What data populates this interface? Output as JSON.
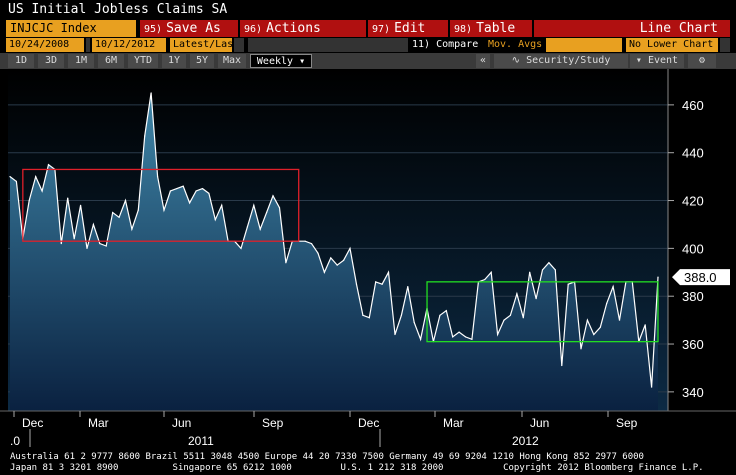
{
  "window": {
    "title": "US Initial Jobless Claims SA"
  },
  "toolbar": {
    "ticker": "INJCJC Index",
    "save": {
      "key": "95)",
      "label": "Save As"
    },
    "actions": {
      "key": "96)",
      "label": "Actions"
    },
    "edit": {
      "key": "97)",
      "label": "Edit"
    },
    "table": {
      "key": "98)",
      "label": "Table"
    },
    "chart_type": "Line Chart"
  },
  "range_bar": {
    "start_date": "10/24/2008",
    "end_date": "10/12/2012",
    "range": "Latest/Last",
    "compare": "11) Compare",
    "mov_avgs": "Mov. Avgs",
    "lower_chart": "No Lower Chart"
  },
  "period_bar": {
    "periods": [
      "1D",
      "3D",
      "1M",
      "6M",
      "YTD",
      "1Y",
      "5Y",
      "Max"
    ],
    "selected": "Weekly",
    "security_study": "Security/Study",
    "event": "Event"
  },
  "colors": {
    "accent": "#e8a020",
    "button_red": "#b01010",
    "line": "#ffffff",
    "box_red": "#e0202a",
    "box_green": "#22dd22"
  },
  "chart_data": {
    "type": "area",
    "title": "US Initial Jobless Claims SA",
    "y_ticks": [
      340,
      360,
      380,
      400,
      420,
      440,
      460
    ],
    "ylim": [
      332,
      475
    ],
    "last_value_label": "388.0",
    "x_month_labels": [
      "Dec",
      "Mar",
      "Jun",
      "Sep",
      "Dec",
      "Mar",
      "Jun",
      "Sep"
    ],
    "year_labels": [
      ".0",
      "2011",
      "2012"
    ],
    "values": [
      430,
      428,
      404,
      420,
      430,
      424,
      435,
      433,
      402,
      421,
      404,
      418,
      400,
      410,
      402,
      401,
      415,
      413,
      420,
      408,
      416,
      447,
      465,
      430,
      416,
      424,
      425,
      426,
      419,
      424,
      425,
      423,
      412,
      418,
      403,
      403,
      400,
      409,
      418,
      408,
      415,
      422,
      417,
      394,
      403,
      403,
      403,
      402,
      398,
      390,
      396,
      393,
      395,
      400,
      385,
      372,
      371,
      386,
      385,
      390,
      364,
      372,
      384,
      369,
      362,
      375,
      361,
      372,
      374,
      363,
      365,
      363,
      362,
      386,
      387,
      390,
      364,
      370,
      372,
      381,
      371,
      390,
      379,
      391,
      394,
      391,
      351,
      385,
      386,
      358,
      370,
      364,
      367,
      377,
      384,
      370,
      386,
      386,
      361,
      368,
      342,
      388
    ],
    "annotations": [
      {
        "type": "rect",
        "color": "red",
        "x_range": [
          2,
          45
        ],
        "y_range": [
          403,
          433
        ]
      },
      {
        "type": "rect",
        "color": "green",
        "x_range": [
          65,
          101
        ],
        "y_range": [
          361,
          386
        ]
      }
    ]
  },
  "footer": {
    "line1": "Australia 61 2 9777 8600 Brazil 5511 3048 4500 Europe 44 20 7330 7500 Germany 49 69 9204 1210 Hong Kong 852 2977 6000",
    "line2": "Japan 81 3 3201 8900          Singapore 65 6212 1000         U.S. 1 212 318 2000           Copyright 2012 Bloomberg Finance L.P."
  }
}
